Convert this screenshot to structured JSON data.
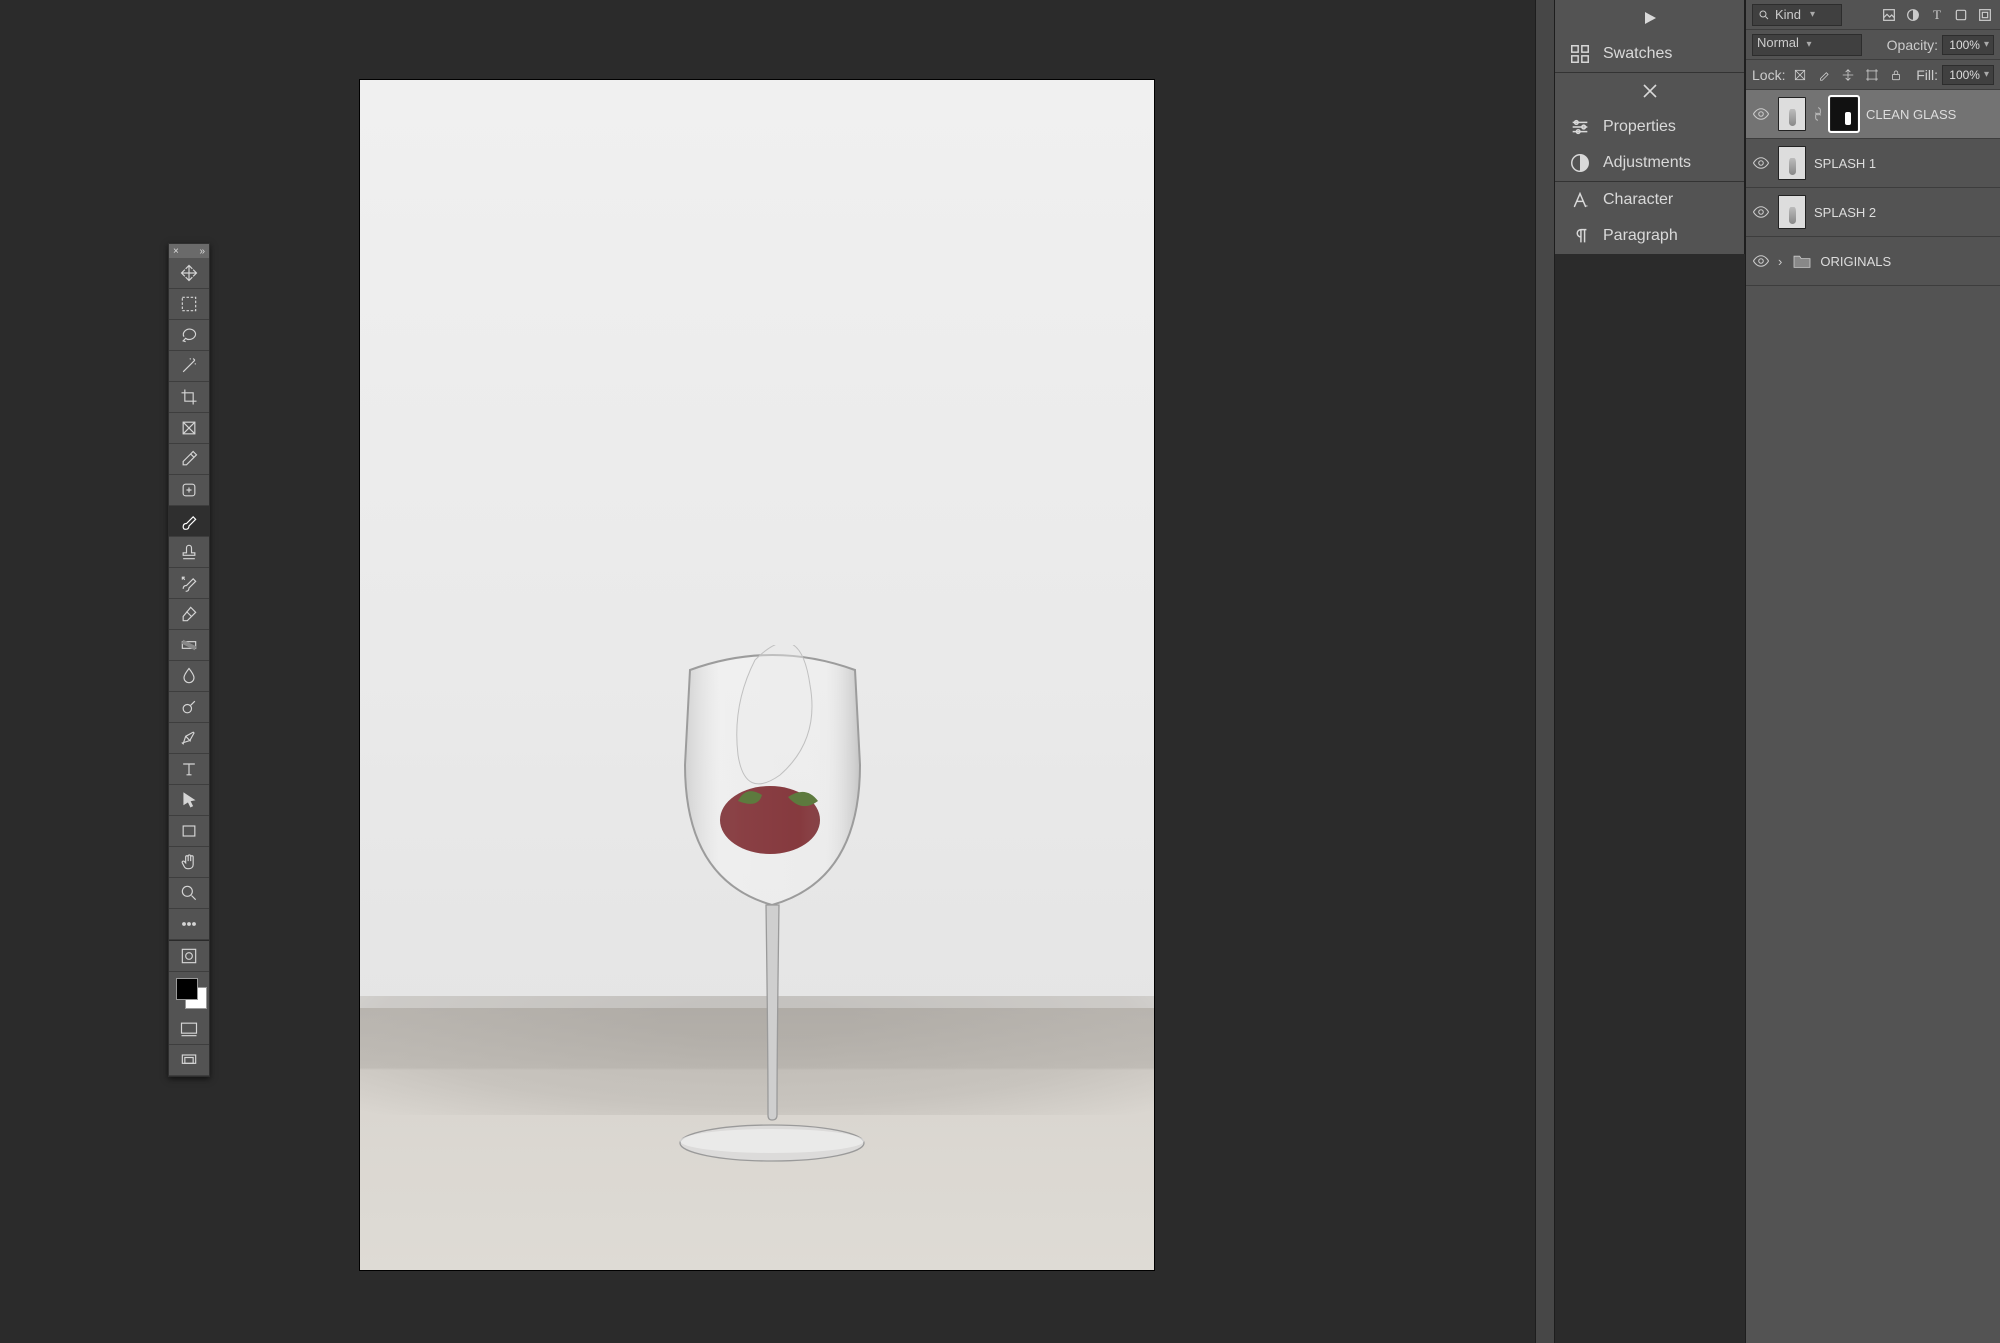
{
  "panels": {
    "swatches": "Swatches",
    "properties": "Properties",
    "adjustments": "Adjustments",
    "character": "Character",
    "paragraph": "Paragraph"
  },
  "layers_panel": {
    "kind_label": "Kind",
    "blend_mode": "Normal",
    "opacity_label": "Opacity:",
    "opacity_value": "100%",
    "lock_label": "Lock:",
    "fill_label": "Fill:",
    "fill_value": "100%",
    "layers": [
      {
        "name": "CLEAN GLASS",
        "has_mask": true,
        "selected": true,
        "type": "layer"
      },
      {
        "name": "SPLASH 1",
        "has_mask": false,
        "selected": false,
        "type": "layer"
      },
      {
        "name": "SPLASH 2",
        "has_mask": false,
        "selected": false,
        "type": "layer"
      },
      {
        "name": "ORIGINALS",
        "has_mask": false,
        "selected": false,
        "type": "group"
      }
    ]
  },
  "toolbar": {
    "tools": [
      "move",
      "marquee",
      "lasso",
      "wand",
      "crop",
      "frame",
      "eyedropper",
      "heal",
      "brush",
      "stamp",
      "history-brush",
      "eraser",
      "gradient",
      "blur",
      "dodge",
      "pen",
      "type",
      "path-select",
      "rectangle",
      "hand",
      "zoom",
      "more"
    ],
    "active": "brush"
  }
}
